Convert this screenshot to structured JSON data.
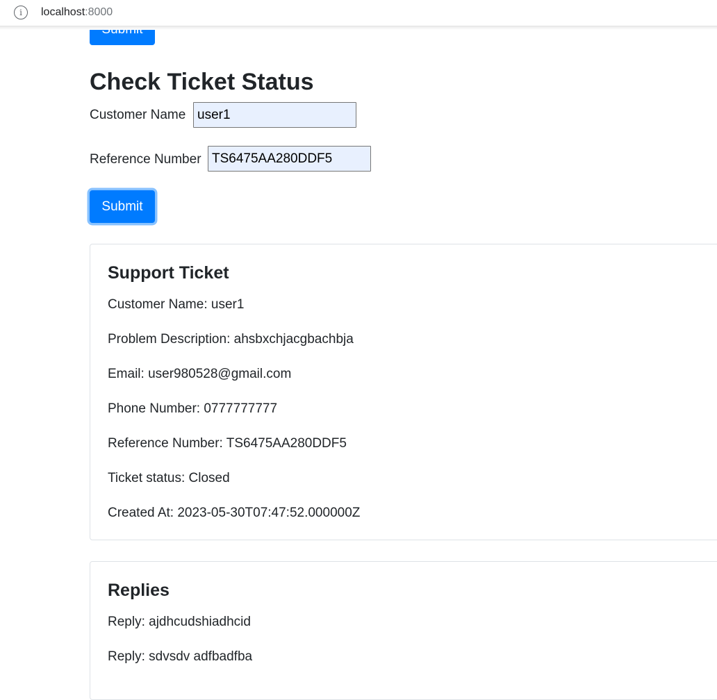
{
  "browser": {
    "url_host": "localhost",
    "url_port": ":8000"
  },
  "top_form": {
    "submit_label": "Submit"
  },
  "check_form": {
    "title": "Check Ticket Status",
    "customer_name_label": "Customer Name",
    "customer_name_value": "user1",
    "reference_label": "Reference Number",
    "reference_value": "TS6475AA280DDF5",
    "submit_label": "Submit"
  },
  "ticket": {
    "heading": "Support Ticket",
    "fields": [
      "Customer Name: user1",
      "Problem Description: ahsbxchjacgbachbja",
      "Email: user980528@gmail.com",
      "Phone Number: 0777777777",
      "Reference Number: TS6475AA280DDF5",
      "Ticket status: Closed",
      "Created At: 2023-05-30T07:47:52.000000Z"
    ]
  },
  "replies": {
    "heading": "Replies",
    "items": [
      "Reply: ajdhcudshiadhcid",
      "Reply: sdvsdv adfbadfba"
    ]
  }
}
